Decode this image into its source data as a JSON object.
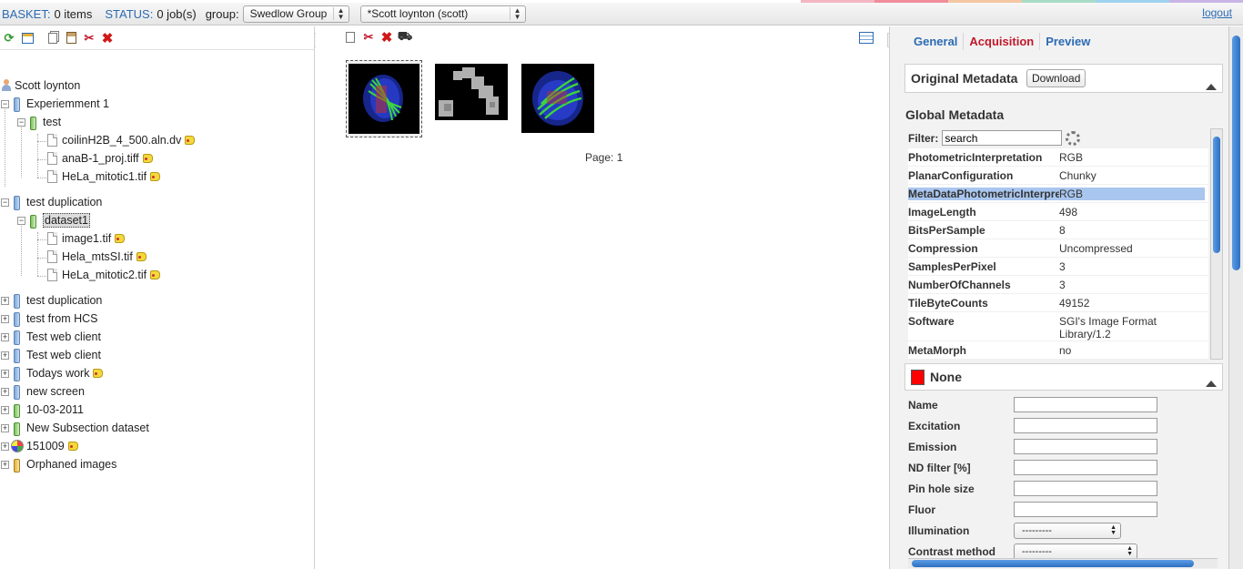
{
  "topbar": {
    "basket_label": "BASKET:",
    "basket_value": "0 items",
    "status_label": "STATUS:",
    "status_value": "0 job(s)",
    "group_label": "group:",
    "group_select": "Swedlow Group",
    "user_select": "*Scott loynton (scott)",
    "logout": "logout"
  },
  "tree": {
    "root": "Scott loynton",
    "p1": "Experiemment 1",
    "p1_ds": "test",
    "p1_img1": "coilinH2B_4_500.aln.dv",
    "p1_img2": "anaB-1_proj.tiff",
    "p1_img3": "HeLa_mitotic1.tif",
    "p2": "test duplication",
    "p2_ds": "dataset1",
    "p2_img1": "image1.tif",
    "p2_img2": "Hela_mtsSI.tif",
    "p2_img3": "HeLa_mitotic2.tif",
    "p3": "test duplication",
    "p4": "test from HCS",
    "p5": "Test web client",
    "p6": "Test web client",
    "p7": "Todays work",
    "p8": "new screen",
    "p9": "10-03-2011",
    "p10": "New Subsection dataset",
    "p11": "151009",
    "p12": "Orphaned images"
  },
  "center": {
    "page_label": "Page: 1"
  },
  "right": {
    "tabs": [
      "General",
      "Acquisition",
      "Preview"
    ],
    "original_metadata": "Original Metadata",
    "download": "Download",
    "global_metadata": "Global Metadata",
    "filter_label": "Filter:",
    "filter_value": "search",
    "metadata": [
      {
        "k": "PhotometricInterpretation",
        "v": "RGB"
      },
      {
        "k": "PlanarConfiguration",
        "v": "Chunky"
      },
      {
        "k": "MetaDataPhotometricInterpretation",
        "v": "RGB"
      },
      {
        "k": "ImageLength",
        "v": "498"
      },
      {
        "k": "BitsPerSample",
        "v": "8"
      },
      {
        "k": "Compression",
        "v": "Uncompressed"
      },
      {
        "k": "SamplesPerPixel",
        "v": "3"
      },
      {
        "k": "NumberOfChannels",
        "v": "3"
      },
      {
        "k": "TileByteCounts",
        "v": "49152"
      },
      {
        "k": "Software",
        "v": "SGI's Image Format Library/1.2"
      },
      {
        "k": "MetaMorph",
        "v": "no"
      }
    ],
    "channel_name": "None",
    "channel_color": "#ff0000",
    "fields": {
      "name": "Name",
      "excitation": "Excitation",
      "emission": "Emission",
      "nd_filter": "ND filter [%]",
      "pin_hole": "Pin hole size",
      "fluor": "Fluor",
      "illumination": "Illumination",
      "illumination_value": "---------",
      "contrast": "Contrast method",
      "contrast_value": "---------"
    }
  }
}
